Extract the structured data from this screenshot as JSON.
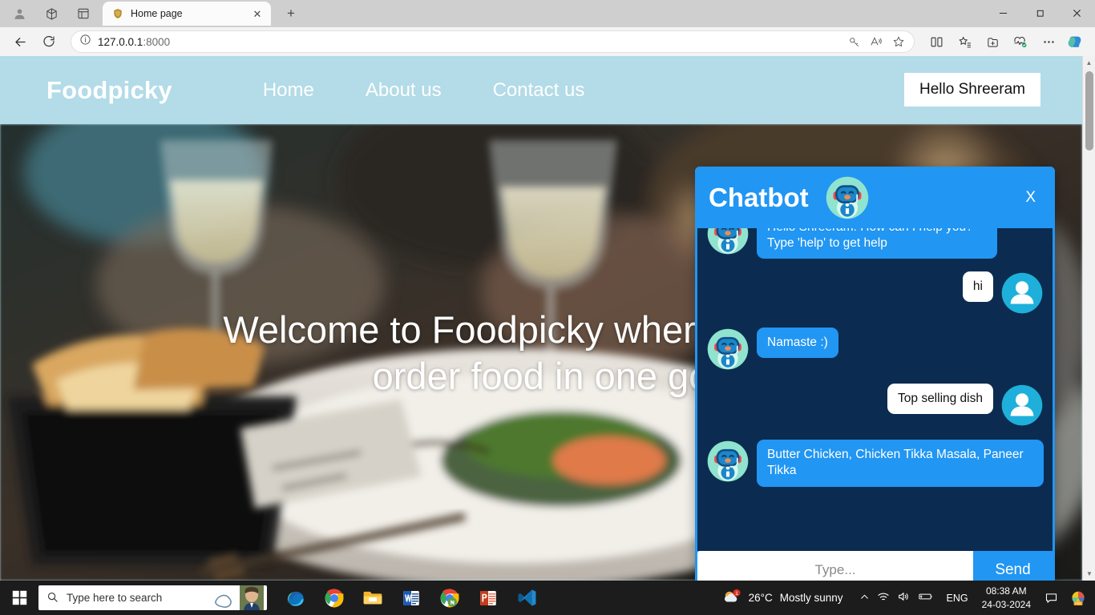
{
  "browser": {
    "tab": {
      "title": "Home page",
      "favicon": "shield-favicon",
      "close_label": "✕"
    },
    "newtab_label": "+",
    "nav": {
      "back_icon": "back-arrow-icon",
      "reload_icon": "reload-icon"
    },
    "address": {
      "info_icon": "info-circle-icon",
      "url_host": "127.0.0.1",
      "url_port": ":8000"
    },
    "omni_actions": [
      "key-icon",
      "read-aloud-icon",
      "favorite-star-icon"
    ],
    "toolbar_right": [
      "split-screen-icon",
      "collections-star-icon",
      "add-collection-icon",
      "browser-essentials-icon",
      "settings-more-icon",
      "copilot-icon"
    ],
    "window_controls": {
      "minimize": "—",
      "maximize": "❐",
      "close": "✕"
    }
  },
  "site": {
    "brand": "Foodpicky",
    "nav_links": [
      "Home",
      "About us",
      "Contact us"
    ],
    "user_button": "Hello Shreeram",
    "hero_caption": "Welcome to Foodpicky where you can\norder food in one go",
    "colors": {
      "navbar": "#b3dbe8",
      "accent": "#2196f3"
    }
  },
  "chatbot": {
    "title": "Chatbot",
    "bot_icon": "robot-headset-icon",
    "close_label": "X",
    "messages": [
      {
        "sender": "bot",
        "text": "Hello Shreeram! How can I help you? Type 'help' to get help"
      },
      {
        "sender": "user",
        "text": "hi"
      },
      {
        "sender": "bot",
        "text": "Namaste :)"
      },
      {
        "sender": "user",
        "text": "Top selling dish"
      },
      {
        "sender": "bot",
        "text": "Butter Chicken, Chicken Tikka Masala, Paneer Tikka"
      }
    ],
    "input_placeholder": "Type...",
    "input_value": "",
    "send_label": "Send"
  },
  "taskbar": {
    "start_icon": "windows-start-icon",
    "search_placeholder": "Type here to search",
    "apps": [
      "edge-icon",
      "chrome-icon",
      "file-explorer-icon",
      "word-icon",
      "chrome-node-icon",
      "powerpoint-icon",
      "vscode-icon"
    ],
    "weather": {
      "temperature": "26°C",
      "condition": "Mostly sunny",
      "badge": "1"
    },
    "tray_icons": [
      "show-hidden-icons-chevron",
      "wifi-icon",
      "volume-icon",
      "battery-icon"
    ],
    "language": "ENG",
    "clock_time": "08:38 AM",
    "clock_date": "24-03-2024",
    "notification_icon": "notification-icon",
    "pre_icon": "pre-app-icon"
  }
}
